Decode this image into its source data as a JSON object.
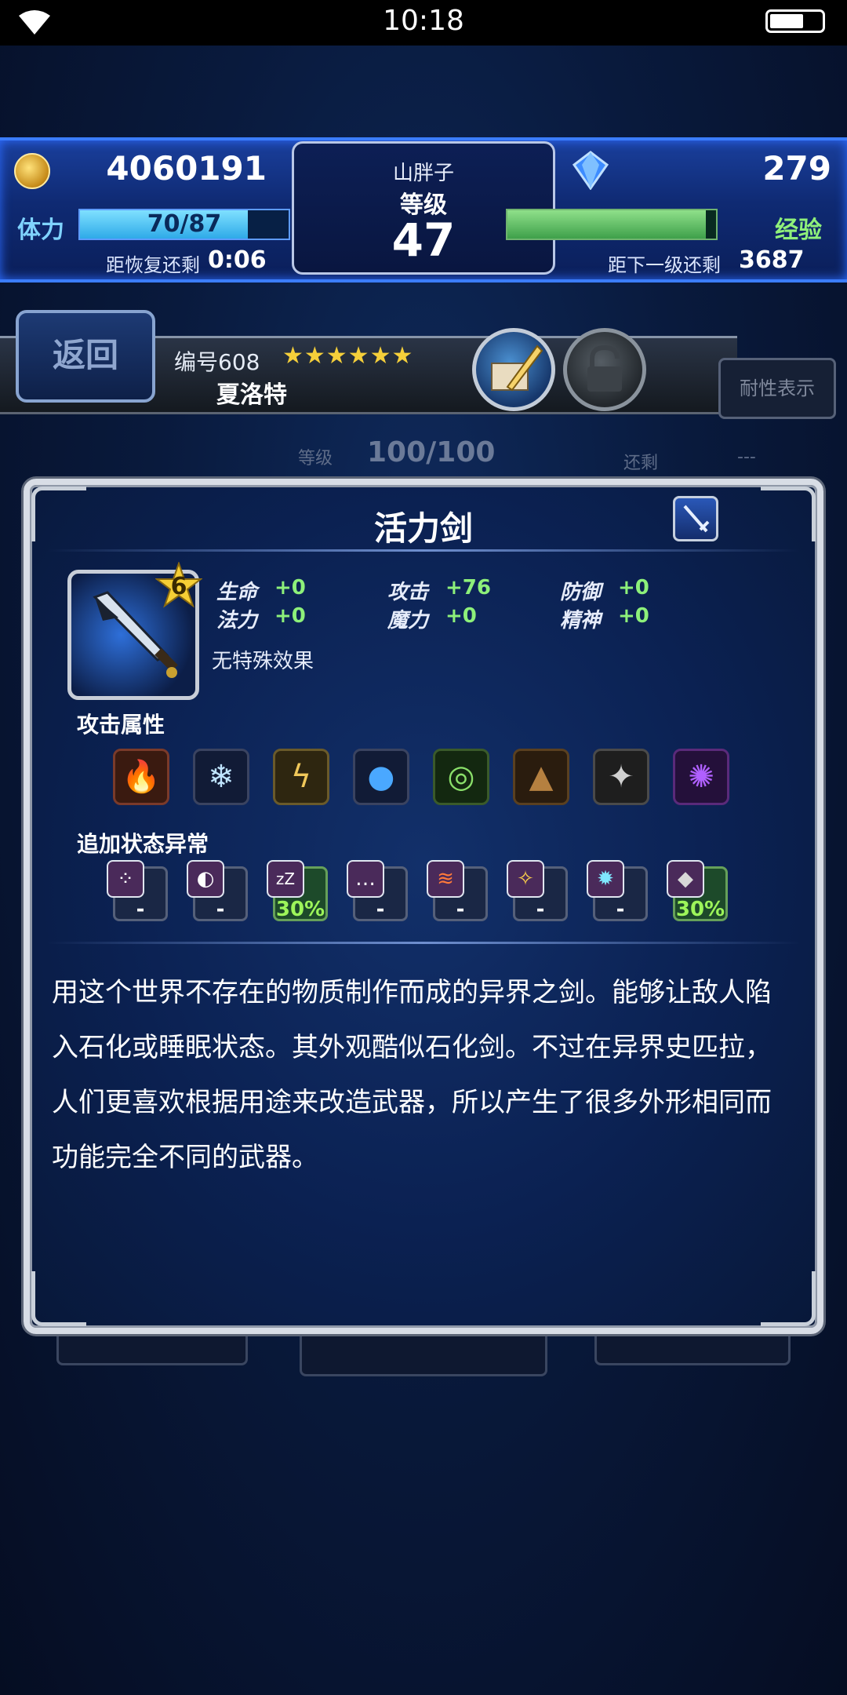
{
  "status_bar": {
    "time": "10:18"
  },
  "hud": {
    "coins": "4060191",
    "gems": "279",
    "player_name": "山胖子",
    "level_label": "等级",
    "level": "47",
    "stamina_label": "体力",
    "stamina": "70/87",
    "stamina_fraction": 0.805,
    "recover_label": "距恢复还剩",
    "recover_time": "0:06",
    "exp_label": "经验",
    "exp_fraction": 0.95,
    "next_level_label": "距下一级还剩",
    "next_level_value": "3687"
  },
  "unit": {
    "back_label": "返回",
    "number": "编号608",
    "stars": "★★★★★★",
    "name": "夏洛特",
    "resist_label": "耐性表示",
    "bg_level_label": "等级",
    "bg_level_value": "100/100",
    "bg_remain_label": "还剩",
    "bg_remain_value": "---"
  },
  "modal": {
    "title": "活力剑",
    "rarity": "6",
    "stats": [
      {
        "label": "生命",
        "value": "+0"
      },
      {
        "label": "法力",
        "value": "+0"
      },
      {
        "label": "攻击",
        "value": "+76"
      },
      {
        "label": "魔力",
        "value": "+0"
      },
      {
        "label": "防御",
        "value": "+0"
      },
      {
        "label": "精神",
        "value": "+0"
      }
    ],
    "special_effect": "无特殊效果",
    "attack_attr_label": "攻击属性",
    "elements": [
      "fire-icon",
      "ice-icon",
      "lightning-icon",
      "water-icon",
      "wind-icon",
      "earth-icon",
      "holy-icon",
      "dark-icon"
    ],
    "ailment_label": "追加状态异常",
    "ailments": [
      {
        "icon": "poison-icon",
        "value": "-"
      },
      {
        "icon": "blind-icon",
        "value": "-"
      },
      {
        "icon": "sleep-icon",
        "value": "30%"
      },
      {
        "icon": "silence-icon",
        "value": "-"
      },
      {
        "icon": "paralysis-icon",
        "value": "-"
      },
      {
        "icon": "confuse-icon",
        "value": "-"
      },
      {
        "icon": "disease-icon",
        "value": "-"
      },
      {
        "icon": "petrify-icon",
        "value": "30%"
      }
    ],
    "description_lines": [
      "用这个世界不存在的物质制作而成的异界之剑。能够让敌人陷",
      "入石化或睡眠状态。其外观酷似石化剑。不过在异界史匹拉，",
      "人们更喜欢根据用途来改造武器，所以产生了很多外形相同而",
      "功能完全不同的武器。"
    ]
  }
}
